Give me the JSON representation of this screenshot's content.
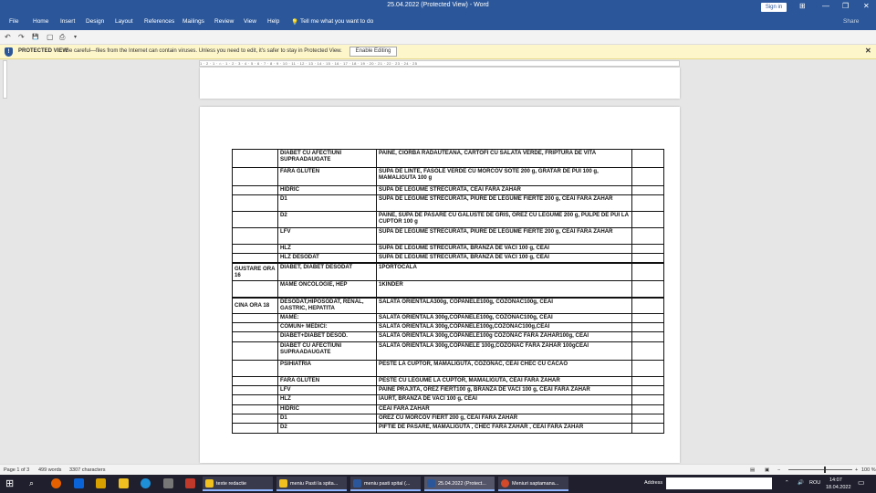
{
  "window": {
    "title": "25.04.2022 (Protected View) - Word",
    "signin": "Sign in",
    "controls": [
      "⊞",
      "—",
      "❐",
      "✕"
    ]
  },
  "ribbon": {
    "tabs": [
      "File",
      "Home",
      "Insert",
      "Design",
      "Layout",
      "References",
      "Mailings",
      "Review",
      "View",
      "Help"
    ],
    "tell_me": "Tell me what you want to do",
    "share": "Share"
  },
  "qat": {
    "icons": [
      "undo-icon",
      "redo-icon",
      "save-icon",
      "new-icon",
      "print-preview-icon",
      "customize-icon"
    ],
    "glyphs": [
      "↶",
      "↷",
      "💾",
      "▢",
      "⎙",
      "▾"
    ]
  },
  "protected": {
    "title": "PROTECTED VIEW",
    "message": "Be careful—files from the Internet can contain viruses. Unless you need to edit, it's safer to stay in Protected View.",
    "button": "Enable Editing"
  },
  "ruler": {
    "text": "1 · 2 · 1 · ⌂ · 1 · 2 · 3 · 4 · 5 · 6 · 7 · 8 · 9 · 10 · 11 · 12 · 13 · 14 · 15 · 16 · 17 · 18 · 19 · 20 · 21 · 22 · 23 · 24 · 25"
  },
  "table": {
    "rows": [
      {
        "meal": "",
        "diet": "DIABET CU AFECTIUNI SUPRAADAUGATE",
        "menu": "PAINE,  CIORBA RADAUTEANA,  CARTOFI CU SALATA VERDE, FRIPTURA DE VITA",
        "h": 20
      },
      {
        "meal": "",
        "diet": "FARA GLUTEN",
        "menu": "SUPA DE LINTE, FASOLE VERDE CU MORCOV SOTE 200 g, GRATAR DE PUI 100 g, MAMALIGUTA 100 g",
        "h": 20
      },
      {
        "meal": "",
        "diet": "HIDRIC",
        "menu": "SUPA DE LEGUME STRECURATA, CEAI FARA ZAHAR",
        "h": 10
      },
      {
        "meal": "",
        "diet": "D1",
        "menu": "SUPA DE LEGUME STRECURATA, PIURE DE LEGUME FIERTE 200 g, CEAI FARA ZAHAR",
        "h": 18
      },
      {
        "meal": "",
        "diet": "D2",
        "menu": "PAINE,  SUPA DE PASARE CU GALUSTE DE GRIS, OREZ CU LEGUME 200 g, PULPE DE PUI LA CUPTOR 100 g",
        "h": 18
      },
      {
        "meal": "",
        "diet": "LFV",
        "menu": "SUPA DE LEGUME STRECURATA, PIURE DE LEGUME FIERTE 200 g, CEAI FARA ZAHAR",
        "h": 18
      },
      {
        "meal": "",
        "diet": "HLZ",
        "menu": "SUPA DE LEGUME STRECURATA, BRANZA DE VACI 100 g, CEAI",
        "h": 10
      },
      {
        "meal": "",
        "diet": "HLZ DESODAT",
        "menu": "SUPA DE LEGUME STRECURATA, BRANZA DE VACI 100 g, CEAI",
        "h": 10
      },
      {
        "meal": "GUSTARE ORA 16",
        "diet": "DIABET, DIABET DESODAT",
        "menu": "1PORTOCALA",
        "h": 20,
        "thick": true
      },
      {
        "meal": "",
        "diet": "MAME ONCOLOGIE, HEP",
        "menu": "1KINDER",
        "h": 18
      },
      {
        "meal": "CINA  ORA 18",
        "diet": "DESODAT,HIPOSODAT, RENAL, GASTRIC, HEPATITA",
        "menu": "SALATA ORIENTALA300g, COPANELE100g, COZONAC100g, CEAI",
        "h": 18,
        "thick": true
      },
      {
        "meal": "",
        "diet": "MAME:",
        "menu": "SALATA ORIENTALA 300g,COPANELE100g, COZONAC100g, CEAI",
        "h": 10
      },
      {
        "meal": "",
        "diet": "COMUN+ MEDICI:",
        "menu": "SALATA ORIENTALA 300g,COPANELE100g,COZONAC100g,CEAI",
        "h": 10
      },
      {
        "meal": "",
        "diet": "DIABET+DIABET DESOD.",
        "menu": "SALATA ORIENTALA 300g,COPANELE100g COZONAC FARA ZAHAR100g, CEAI",
        "h": 11
      },
      {
        "meal": "",
        "diet": "DIABET CU AFECTIUNI SUPRAADAUGATE",
        "menu": "SALATA ORIENTALA 300g,COPANELE 100g,COZONAC FARA ZAHAR 100gCEAI",
        "h": 20
      },
      {
        "meal": "",
        "diet": "PSIHIATRIA",
        "menu": "PESTE LA CUPTOR, MAMALIGUTA, COZONAC, CEAI CHEC  CU CACAO",
        "h": 18
      },
      {
        "meal": "",
        "diet": "FARA GLUTEN",
        "menu": "PESTE CU LEGUME LA CUPTOR, MAMALIGUTA, CEAI FARA ZAHAR",
        "h": 10
      },
      {
        "meal": "",
        "diet": "LFV",
        "menu": "PAINE PRAJITA, OREZ FIERT100 g, BRANZA DE VACI 100 g, CEAI FARA ZAHAR",
        "h": 10
      },
      {
        "meal": "",
        "diet": "HLZ",
        "menu": "IAURT, BRANZA DE VACI 100 g, CEAI",
        "h": 11
      },
      {
        "meal": "",
        "diet": "HIDRIC",
        "menu": "CEAI FARA ZAHAR",
        "h": 10
      },
      {
        "meal": "",
        "diet": "D1",
        "menu": "OREZ CU MORCOV FIERT 200 g, CEAI FARA ZAHAR",
        "h": 10
      },
      {
        "meal": "",
        "diet": "D2",
        "menu": "PIFTIE DE PASARE, MAMALIGUTA , CHEC FARA ZAHAR , CEAI FARA ZAHAR",
        "h": 11
      }
    ]
  },
  "status": {
    "page": "Page 1 of 3",
    "words": "499 words",
    "chars": "3307 characters",
    "zoom": "100 %"
  },
  "taskbar": {
    "tasks": [
      "texte redactie",
      "meniu Pasti la spita...",
      "meniu pasti spital (...",
      "25.04.2022 (Protect...",
      "Meniuri saptamana..."
    ],
    "address_label": "Address",
    "lang": "ROU",
    "time": "14:07",
    "date": "18.04.2022"
  }
}
